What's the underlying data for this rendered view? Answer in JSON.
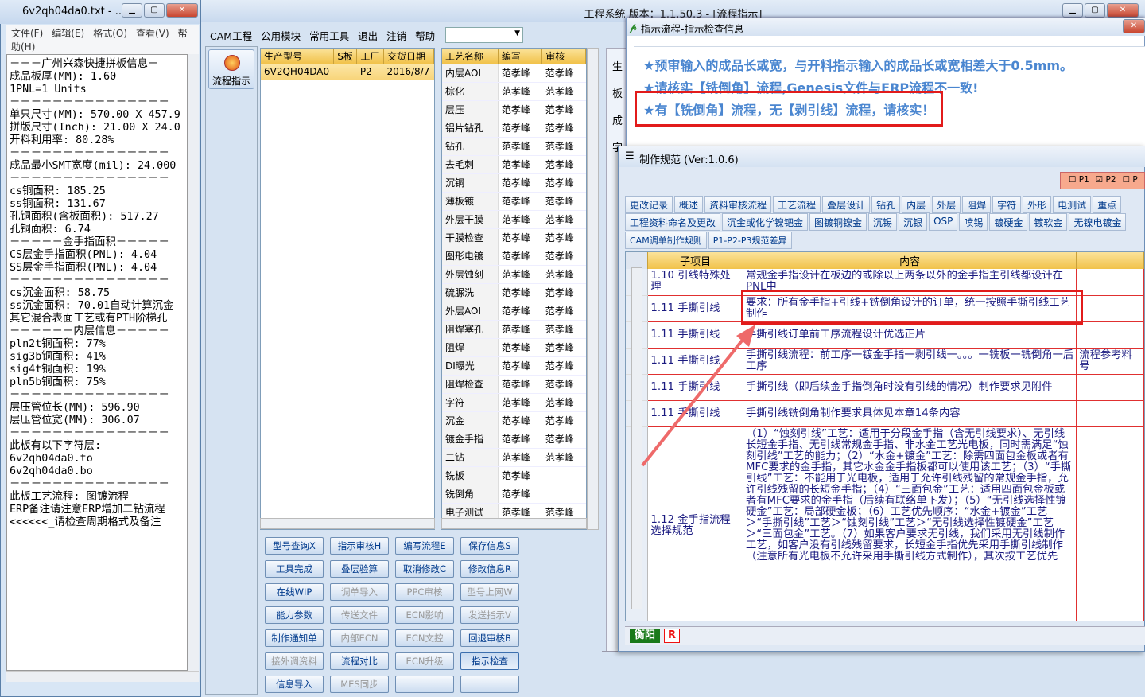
{
  "notepad": {
    "title": "6v2qh04da0.txt - ...",
    "menu": [
      "文件(F)",
      "编辑(E)",
      "格式(O)",
      "查看(V)",
      "帮助(H)"
    ],
    "lines": [
      "－－－广州兴森快捷拼板信息－",
      "成品板厚(MM): 1.60",
      "1PNL=1 Units",
      "－－－－－－－－－－－－－－－",
      "单只尺寸(MM): 570.00 X 457.9",
      "拼版尺寸(Inch): 21.00 X 24.0",
      "开料利用率: 80.28%",
      "－－－－－－－－－－－－－－－",
      "成品最小SMT宽度(mil): 24.000",
      "－－－－－－－－－－－－－－－",
      "cs铜面积: 185.25",
      "ss铜面积: 131.67",
      "孔铜面积(含板面积): 517.27",
      "孔铜面积: 6.74",
      "－－－－－金手指面积－－－－－",
      "CS层金手指面积(PNL): 4.04",
      "SS层金手指面积(PNL): 4.04",
      "－－－－－－－－－－－－－－－",
      "cs沉金面积: 58.75",
      "ss沉金面积: 70.01自动计算沉金",
      "其它混合表面工艺或有PTH阶梯孔",
      "－－－－－－内层信息－－－－－",
      "pln2t铜面积: 77%",
      "sig3b铜面积: 41%",
      "sig4t铜面积: 19%",
      "pln5b铜面积: 75%",
      "－－－－－－－－－－－－－－－",
      "层压管位长(MM): 596.90",
      "层压管位宽(MM): 306.07",
      "－－－－－－－－－－－－－－－",
      "此板有以下字符层:",
      "6v2qh04da0.to",
      "6v2qh04da0.bo",
      "－－－－－－－－－－－－－－－",
      "此板工艺流程: 图镀流程",
      "ERP备注请注意ERP增加二钻流程",
      "<<<<<<_请检查周期格式及备注"
    ]
  },
  "app": {
    "title": "工程系统   版本：1.1.50.3 - [流程指示]",
    "menu": [
      "CAM工程",
      "公用模块",
      "常用工具",
      "退出",
      "注销",
      "帮助"
    ],
    "left_button": "流程指示",
    "grid1": {
      "headers": [
        "生产型号",
        "S板",
        "工厂",
        "交货日期"
      ],
      "row": [
        "6V2QH04DA0",
        "",
        "P2",
        "2016/8/7"
      ]
    },
    "grid2": {
      "headers": [
        "工艺名称",
        "编写",
        "审核"
      ],
      "rows": [
        [
          "内层AOI",
          "范孝峰",
          "范孝峰"
        ],
        [
          "棕化",
          "范孝峰",
          "范孝峰"
        ],
        [
          "层压",
          "范孝峰",
          "范孝峰"
        ],
        [
          "铝片钻孔",
          "范孝峰",
          "范孝峰"
        ],
        [
          "钻孔",
          "范孝峰",
          "范孝峰"
        ],
        [
          "去毛刺",
          "范孝峰",
          "范孝峰"
        ],
        [
          "沉铜",
          "范孝峰",
          "范孝峰"
        ],
        [
          "薄板镀",
          "范孝峰",
          "范孝峰"
        ],
        [
          "外层干膜",
          "范孝峰",
          "范孝峰"
        ],
        [
          "干膜检查",
          "范孝峰",
          "范孝峰"
        ],
        [
          "图形电镀",
          "范孝峰",
          "范孝峰"
        ],
        [
          "外层蚀刻",
          "范孝峰",
          "范孝峰"
        ],
        [
          "硫脲洗",
          "范孝峰",
          "范孝峰"
        ],
        [
          "外层AOI",
          "范孝峰",
          "范孝峰"
        ],
        [
          "阻焊塞孔",
          "范孝峰",
          "范孝峰"
        ],
        [
          "阻焊",
          "范孝峰",
          "范孝峰"
        ],
        [
          "DI曝光",
          "范孝峰",
          "范孝峰"
        ],
        [
          "阻焊检查",
          "范孝峰",
          "范孝峰"
        ],
        [
          "字符",
          "范孝峰",
          "范孝峰"
        ],
        [
          "沉金",
          "范孝峰",
          "范孝峰"
        ],
        [
          "镀金手指",
          "范孝峰",
          "范孝峰"
        ],
        [
          "二钻",
          "范孝峰",
          "范孝峰"
        ],
        [
          "铣板",
          "范孝峰",
          ""
        ],
        [
          "铣倒角",
          "范孝峰",
          ""
        ],
        [
          "电子测试",
          "范孝峰",
          "范孝峰"
        ]
      ]
    },
    "buttons": [
      [
        "型号查询X",
        "指示审核H",
        "编写流程E",
        "保存信息S"
      ],
      [
        "工具完成",
        "叠层验算",
        "取消修改C",
        "修改信息R"
      ],
      [
        "在线WIP",
        "调单导入",
        "PPC审核",
        "型号上网W"
      ],
      [
        "能力参数",
        "传送文件",
        "ECN影响",
        "发送指示V"
      ],
      [
        "制作通知单",
        "内部ECN",
        "ECN文控",
        "回退审核B"
      ],
      [
        "接外调资料",
        "流程对比",
        "ECN升级",
        "指示检查"
      ],
      [
        "信息导入",
        "MES同步",
        "",
        ""
      ]
    ],
    "disabled": [
      "调单导入",
      "PPC审核",
      "型号上网W",
      "传送文件",
      "ECN影响",
      "发送指示V",
      "内部ECN",
      "ECN文控",
      "接外调资料",
      "ECN升级",
      "MES同步"
    ]
  },
  "check_window": {
    "title": "指示流程-指示检查信息",
    "messages": [
      "★预审输入的成品长或宽，与开料指示输入的成品长或宽相差大于0.5mm。",
      "★请核实【铣倒角】流程,Genesis文件与ERP流程不一致!",
      "★有【铣倒角】流程，无【剥引线】流程，请核实！"
    ]
  },
  "spec_window": {
    "title": "制作规范 (Ver:1.0.6)",
    "toggles": [
      "P1",
      "P2",
      "P"
    ],
    "tabs1": [
      "更改记录",
      "概述",
      "资料审核流程",
      "工艺流程",
      "叠层设计",
      "钻孔",
      "内层",
      "外层",
      "阻焊",
      "字符",
      "外形",
      "电测试",
      "重点"
    ],
    "tabs2": [
      "工程资料命名及更改",
      "沉金或化学镍钯金",
      "图镀铜镍金",
      "沉锡",
      "沉银",
      "OSP",
      "喷锡",
      "镀硬金",
      "镀软金",
      "无镍电镀金"
    ],
    "tabs3": [
      "CAM调单制作规则",
      "P1-P2-P3规范差异"
    ],
    "headers": [
      "子项目",
      "内容"
    ],
    "rows": [
      [
        "1.10 引线特殊处理",
        "常规金手指设计在板边的或除以上两条以外的金手指主引线都设计在PNL中",
        ""
      ],
      [
        "1.11 手撕引线",
        "要求：所有金手指+引线+铣倒角设计的订单，统一按照手撕引线工艺制作",
        ""
      ],
      [
        "1.11 手撕引线",
        "手撕引线订单前工序流程设计优选正片",
        ""
      ],
      [
        "1.11 手撕引线",
        "手撕引线流程：前工序一镀金手指一剥引线一。。。一铣板一铣倒角一后工序",
        "流程参考料号"
      ],
      [
        "1.11 手撕引线",
        "手撕引线（即后续金手指倒角时没有引线的情况）制作要求见附件",
        ""
      ],
      [
        "1.11 手撕引线",
        "手撕引线铣倒角制作要求具体见本章14条内容",
        ""
      ],
      [
        "1.12 金手指流程选择规范",
        "（1）“蚀刻引线”工艺：适用于分段金手指（含无引线要求）、无引线长短金手指、无引线常规金手指、非水金工艺光电板，同时需满足“蚀刻引线”工艺的能力；（2）“水金+镀金”工艺：除需四面包金板或者有MFC要求的金手指，其它水金金手指板都可以使用该工艺；（3）“手撕引线”工艺：不能用于光电板，适用于允许引线残留的常规金手指，允许引线残留的长短金手指；（4）“三面包金”工艺：适用四面包金板或者有MFC要求的金手指（后续有联络单下发）；（5）“无引线选择性镀硬金”工艺：局部硬金板；（6）工艺优先顺序：“水金+镀金”工艺＞“手撕引线”工艺＞“蚀刻引线”工艺＞“无引线选择性镀硬金”工艺＞“三面包金”工艺。（7）如果客户要求无引线，我们采用无引线制作工艺，如客户没有引线残留要求，长短金手指优先采用手撕引线制作（注意所有光电板不允许采用手撕引线方式制作），其次按工艺优先",
        ""
      ]
    ],
    "footer_a": "衡阳",
    "footer_b": "R"
  },
  "side_labels": [
    "生",
    "板",
    "成",
    "字"
  ],
  "colors": {
    "accent": "#4a86d0",
    "highlight": "#e21b1b",
    "header": "#f1c24a"
  }
}
